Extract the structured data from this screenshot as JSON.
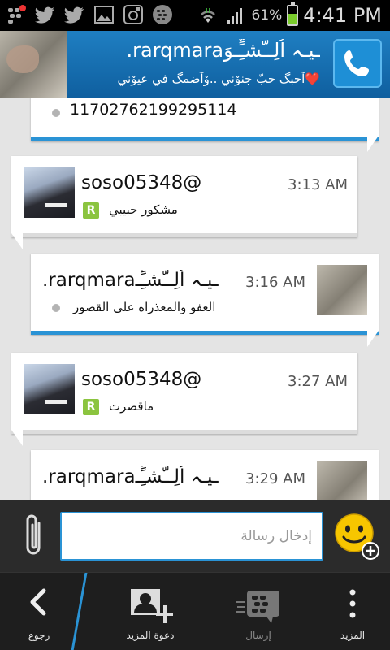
{
  "status_bar": {
    "icons": [
      "bbm-notification-icon",
      "twitter-icon",
      "twitter-icon",
      "gallery-icon",
      "instagram-icon",
      "blackberry-icon",
      "wifi-icon",
      "signal-icon"
    ],
    "battery_percent": "61%",
    "battery_level": 0.61,
    "time": "4:41 PM"
  },
  "header": {
    "contact_name": ".rarqmaraـيـہ اُلِــّشـٍِّـوَ",
    "status_message": "آحبگ حبّ جنۆني ..ۆآضمگ في عيۆني❤️",
    "call_icon": "phone-icon"
  },
  "messages": [
    {
      "direction": "out",
      "text": "11702762199295114",
      "partial": true
    },
    {
      "direction": "in",
      "sender": "soso05348@",
      "time": "3:13 AM",
      "text": "مشكور حبيبي",
      "badge": "R"
    },
    {
      "direction": "out",
      "sender": ".rarqmaraـيـہ اُلِــّشـٍِّـ",
      "time": "3:16 AM",
      "text": "العفو والمعذراه على القصور"
    },
    {
      "direction": "in",
      "sender": "soso05348@",
      "time": "3:27 AM",
      "text": "ماقصرت",
      "badge": "R"
    },
    {
      "direction": "out",
      "sender": ".rarqmaraـيـہ اُلِــّشـٍِّـ",
      "time": "3:29 AM",
      "partial": true
    }
  ],
  "composer": {
    "placeholder": "إدخال رسالة",
    "attach_icon": "paperclip-icon",
    "emoticon_icon": "smiley-add-icon"
  },
  "action_bar": {
    "back_label": "رجوع",
    "invite_label": "دعوة المزيد",
    "send_label": "إرسال",
    "more_label": "المزيد"
  },
  "colors": {
    "accent": "#2a93d5",
    "header": "#1b78bb",
    "badge_green": "#8bc43f"
  }
}
